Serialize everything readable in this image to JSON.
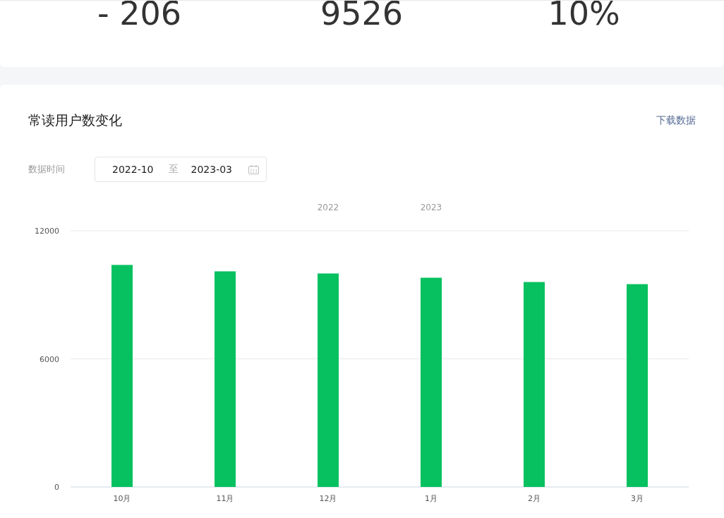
{
  "summary": {
    "values": [
      "- 206",
      "9526",
      "10%"
    ]
  },
  "panel": {
    "title": "常读用户数变化",
    "download": "下载数据",
    "date_label": "数据时间",
    "date_range": {
      "start": "2022-10",
      "separator": "至",
      "end": "2023-03"
    },
    "chart_data": {
      "type": "bar",
      "categories": [
        "10月",
        "11月",
        "12月",
        "1月",
        "2月",
        "3月"
      ],
      "series": [
        {
          "color": "#07c160",
          "values": [
            10400,
            10100,
            10000,
            9800,
            9600,
            9500
          ]
        }
      ],
      "ylim": [
        0,
        12000
      ],
      "yticks": [
        0,
        6000,
        12000
      ],
      "annotations": [
        "2022",
        "2023"
      ]
    }
  }
}
